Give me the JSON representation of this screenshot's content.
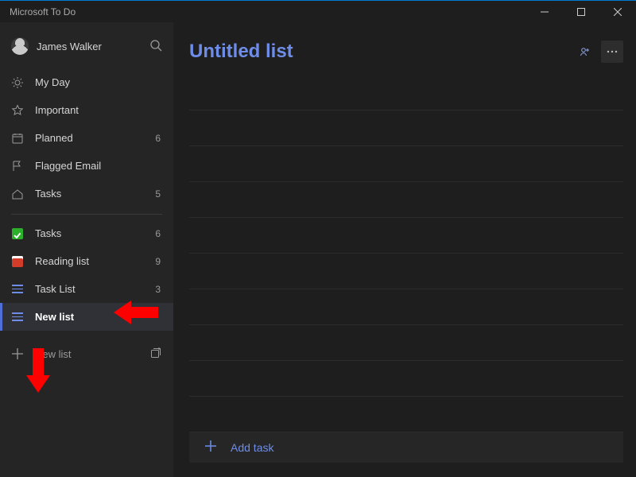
{
  "window": {
    "title": "Microsoft To Do"
  },
  "profile": {
    "name": "James Walker"
  },
  "smart_lists": [
    {
      "id": "myday",
      "label": "My Day",
      "count": null
    },
    {
      "id": "important",
      "label": "Important",
      "count": null
    },
    {
      "id": "planned",
      "label": "Planned",
      "count": 6
    },
    {
      "id": "flagged",
      "label": "Flagged Email",
      "count": null
    },
    {
      "id": "tasks",
      "label": "Tasks",
      "count": 5
    }
  ],
  "user_lists": [
    {
      "id": "tasks2",
      "label": "Tasks",
      "count": 6,
      "icon": "green-check"
    },
    {
      "id": "reading",
      "label": "Reading list",
      "count": 9,
      "icon": "red-square"
    },
    {
      "id": "tasklist",
      "label": "Task List",
      "count": 3,
      "icon": "hamburger"
    },
    {
      "id": "newlist",
      "label": "New list",
      "count": null,
      "icon": "hamburger",
      "selected": true
    }
  ],
  "add_list": {
    "label": "New list"
  },
  "main": {
    "title": "Untitled list",
    "add_task_label": "Add task",
    "empty_line_count": 10
  },
  "colors": {
    "accent": "#6e8de8"
  }
}
